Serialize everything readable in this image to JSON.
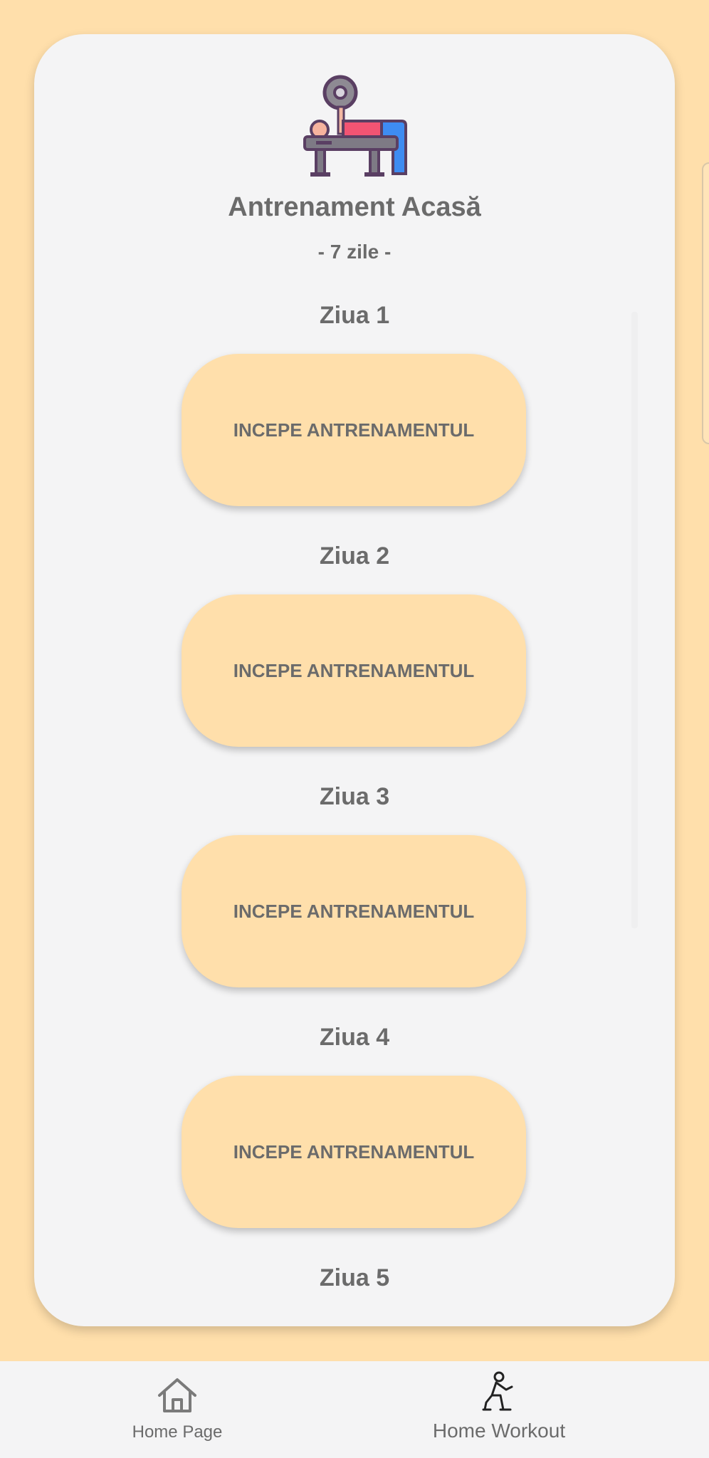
{
  "header": {
    "title": "Antrenament Acasă",
    "subtitle": "- 7 zile -",
    "logo_icon": "bench-press-icon"
  },
  "days": [
    {
      "label": "Ziua 1",
      "button_label": "INCEPE ANTRENAMENTUL"
    },
    {
      "label": "Ziua 2",
      "button_label": "INCEPE ANTRENAMENTUL"
    },
    {
      "label": "Ziua 3",
      "button_label": "INCEPE ANTRENAMENTUL"
    },
    {
      "label": "Ziua 4",
      "button_label": "INCEPE ANTRENAMENTUL"
    },
    {
      "label": "Ziua 5"
    }
  ],
  "bottom_nav": {
    "items": [
      {
        "label": "Home Page",
        "icon": "home-icon",
        "active": false
      },
      {
        "label": "Home Workout",
        "icon": "exercise-person-icon",
        "active": true
      }
    ]
  },
  "colors": {
    "background": "#FFDFAB",
    "card": "#F4F4F5",
    "button": "#FFDFAB",
    "text": "#6B6B6B"
  }
}
